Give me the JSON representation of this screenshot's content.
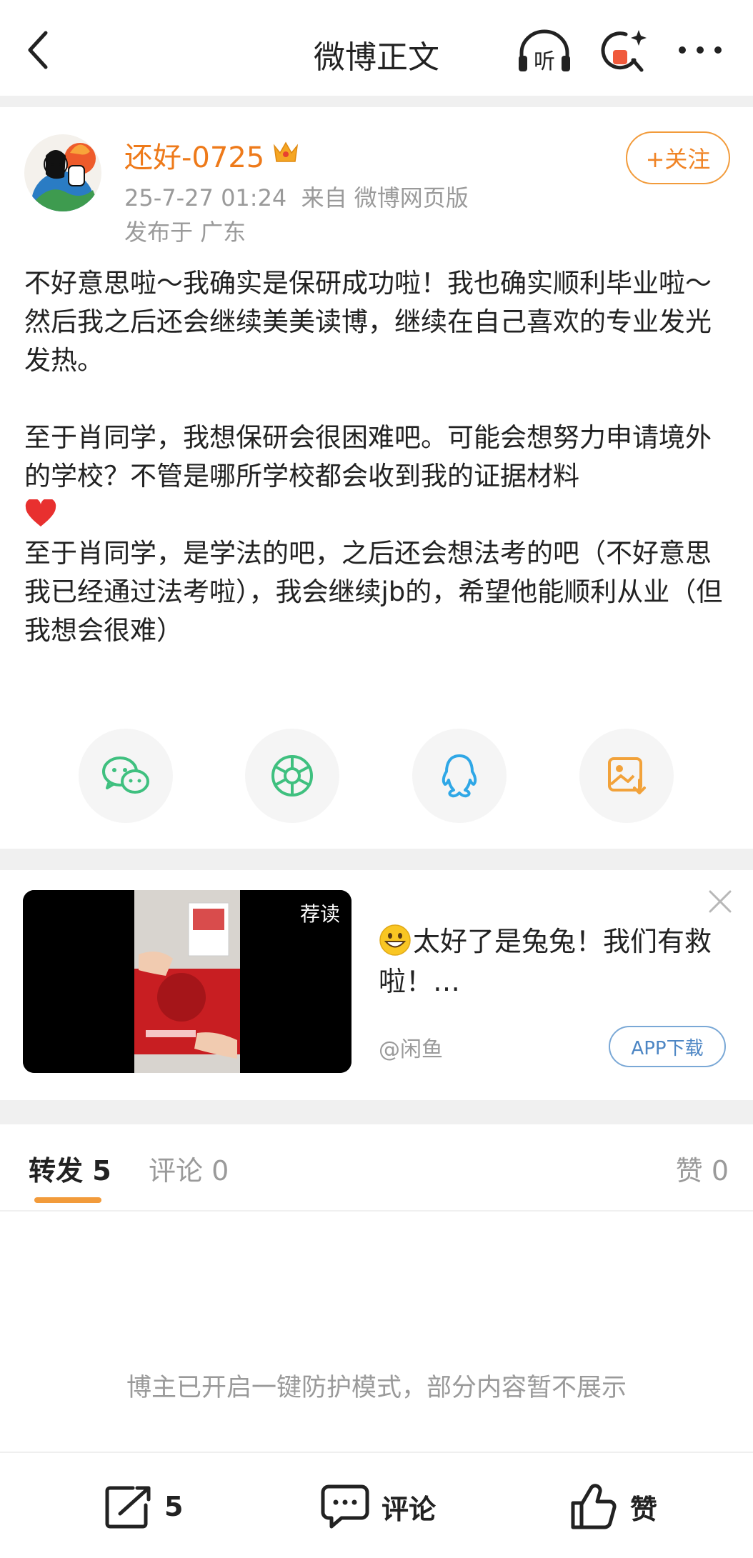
{
  "header": {
    "title": "微博正文",
    "icons": [
      "back-arrow-icon",
      "listen-icon",
      "ai-search-icon",
      "more-icon"
    ],
    "listen_label": "听"
  },
  "post": {
    "username": "还好-0725",
    "meta": "25-7-27 01:24  来自 微博网页版",
    "location": "发布于 广东",
    "follow_label": "+关注",
    "paragraphs": [
      "不好意思啦～我确实是保研成功啦！我也确实顺利毕业啦～",
      "然后我之后还会继续美美读博，继续在自己喜欢的专业发光发热。",
      "",
      "至于肖同学，我想保研会很困难吧。可能会想努力申请境外的学校？不管是哪所学校都会收到我的证据材料",
      "至于肖同学，是学法的吧，之后还会想法考的吧（不好意思我已经通过法考啦），我会继续jb的，希望他能顺利从业（但我想会很难）"
    ],
    "share_targets": [
      "wechat-icon",
      "moments-icon",
      "qq-icon",
      "save-image-icon"
    ]
  },
  "ad": {
    "badge": "荐读",
    "title": "太好了是兔兔！我们有救啦！…",
    "source": "@闲鱼",
    "download_label": "APP下载"
  },
  "tabs": {
    "repost": "转发 5",
    "comment": "评论 0",
    "like": "赞 0"
  },
  "notice": "博主已开启一键防护模式，部分内容暂不展示",
  "bottom_bar": {
    "repost_count": "5",
    "comment_label": "评论",
    "like_label": "赞"
  },
  "colors": {
    "accent_orange": "#ee7a1a",
    "wechat_green": "#3fc07f",
    "qq_blue": "#2fa7e6",
    "save_orange": "#f2a23a"
  }
}
